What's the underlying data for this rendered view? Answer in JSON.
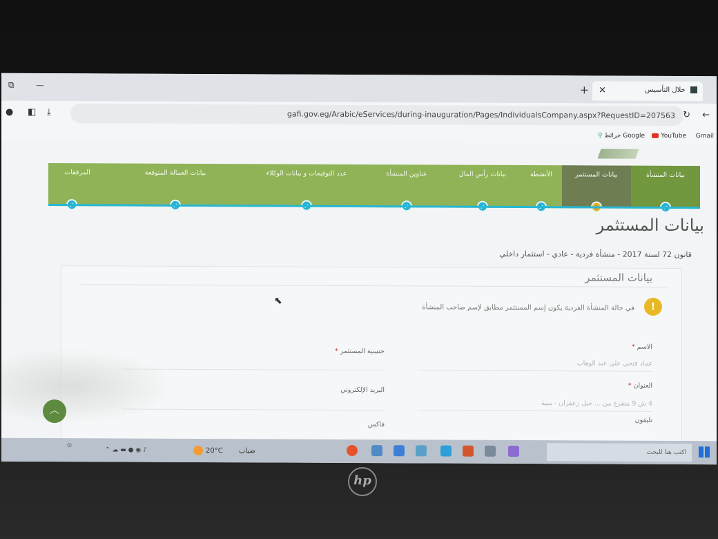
{
  "browser": {
    "tab_title": "خلال التأسيس",
    "url": "gafi.gov.eg/Arabic/eServices/during-inauguration/Pages/IndividualsCompany.aspx?RequestID=207563",
    "bookmarks": [
      "Gmail",
      "YouTube",
      "خرائط Google"
    ]
  },
  "steps": [
    {
      "label": "بيانات المنشأة",
      "state": "done"
    },
    {
      "label": "بيانات المستثمر",
      "state": "active"
    },
    {
      "label": "الأنشطة",
      "state": "done"
    },
    {
      "label": "بيانات رأس المال",
      "state": "done"
    },
    {
      "label": "عناوين المنشأة",
      "state": "done"
    },
    {
      "label": "عدد التوقيعات و بيانات الوكلاء",
      "state": "done"
    },
    {
      "label": "بيانات العمالة المتوقعة",
      "state": "done"
    },
    {
      "label": "المرفقات",
      "state": "done"
    }
  ],
  "page": {
    "title": "بيانات المستثمر",
    "subtitle": "قانون 72 لسنة 2017 - منشأة فردية - عادي - استثمار داخلي",
    "panel_heading": "بيانات المستثمر",
    "notice": "في حالة المنشأة الفردية يكون إسم المستثمر مطابق لإسم صاحب المنشأة",
    "fields": {
      "name_label": "الاسم",
      "name_value": "عماد فتحي علي عبد الوهاب",
      "nationality_label": "جنسية المستثمر",
      "address_label": "العنوان",
      "address_value": "4 ش 9 متفرع من ... جبل زعفران - منية",
      "email_label": "البريد الإلكتروني",
      "phone_label": "تليفون",
      "fax_label": "فاكس"
    }
  },
  "taskbar": {
    "search_placeholder": "اكتب هنا للبحث",
    "weather": "20°C",
    "weather_desc": "ضباب"
  },
  "colors": {
    "stepper_green": "#8fb356",
    "active_step": "#6f7d52",
    "progress_cyan": "#27b7d5",
    "notice_yellow": "#e9b825"
  }
}
